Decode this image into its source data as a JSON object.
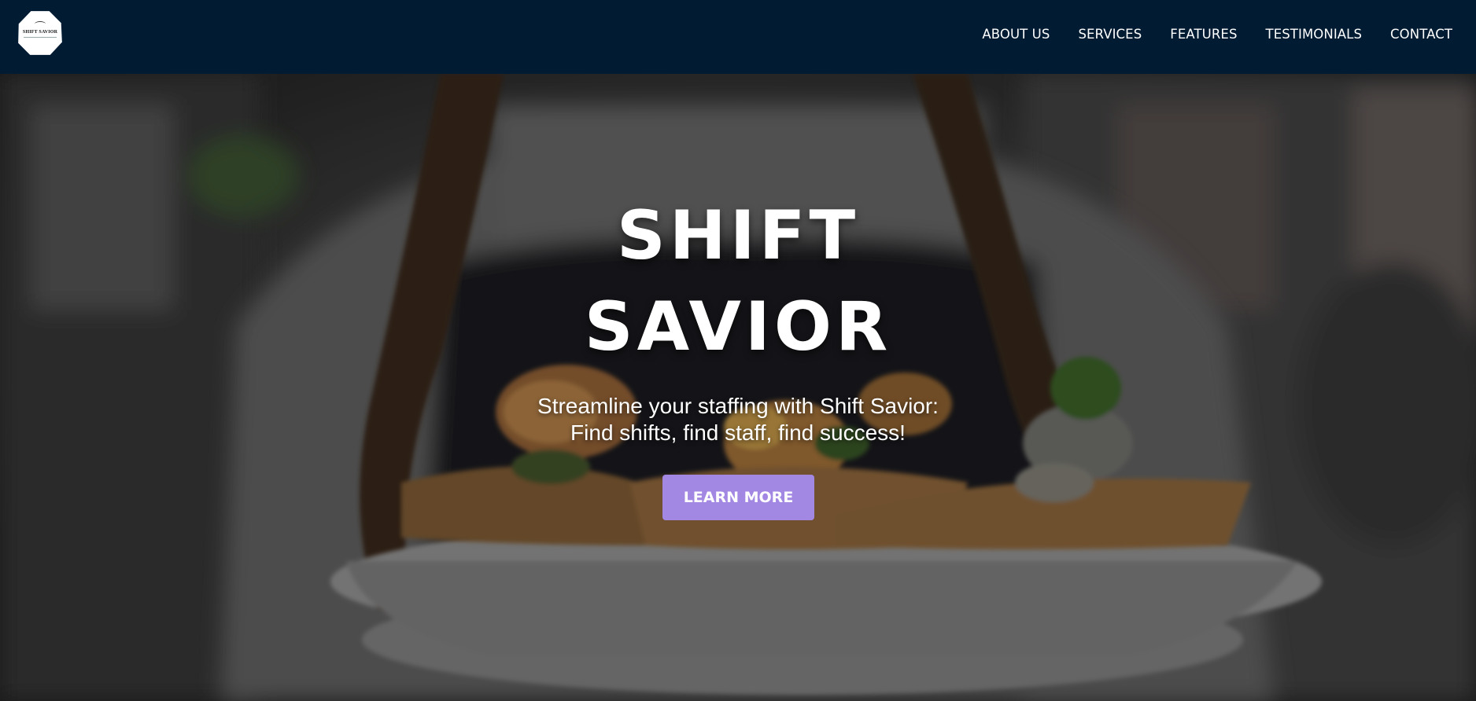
{
  "header": {
    "logo_text": "SHIFT SAVIOR",
    "bg_color": "#011b33",
    "nav": [
      {
        "label": "ABOUT US"
      },
      {
        "label": "SERVICES"
      },
      {
        "label": "FEATURES"
      },
      {
        "label": "TESTIMONIALS"
      },
      {
        "label": "CONTACT"
      }
    ]
  },
  "hero": {
    "title_line1": "SHIFT",
    "title_line2": "SAVIOR",
    "subtitle_line1": "Streamline your staffing with Shift Savior:",
    "subtitle_line2": "Find shifts, find staff, find success!",
    "cta_label": "LEARN MORE",
    "cta_color": "#a287e3"
  }
}
